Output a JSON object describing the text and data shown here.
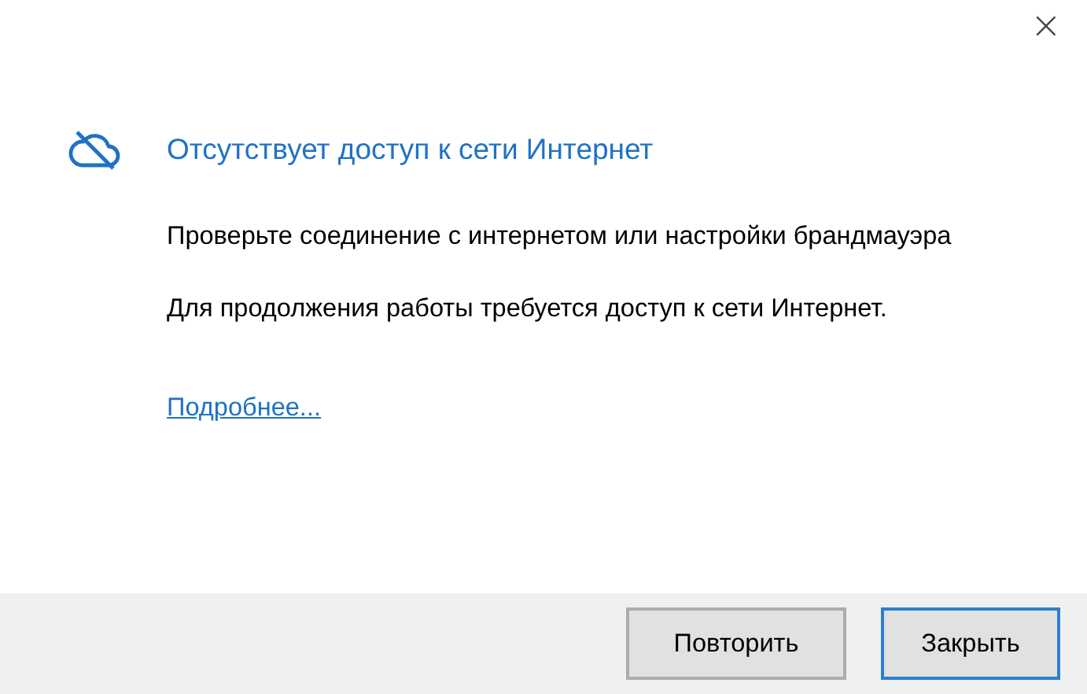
{
  "dialog": {
    "close": "×",
    "title": "Отсутствует доступ к сети Интернет",
    "paragraphs": [
      "Проверьте соединение с интернетом или настройки брандмауэра",
      "Для продолжения работы требуется доступ к сети Интернет."
    ],
    "link": "Подробнее...",
    "buttons": [
      {
        "label": "Повторить",
        "selected": false
      },
      {
        "label": "Закрыть",
        "selected": true
      }
    ]
  }
}
